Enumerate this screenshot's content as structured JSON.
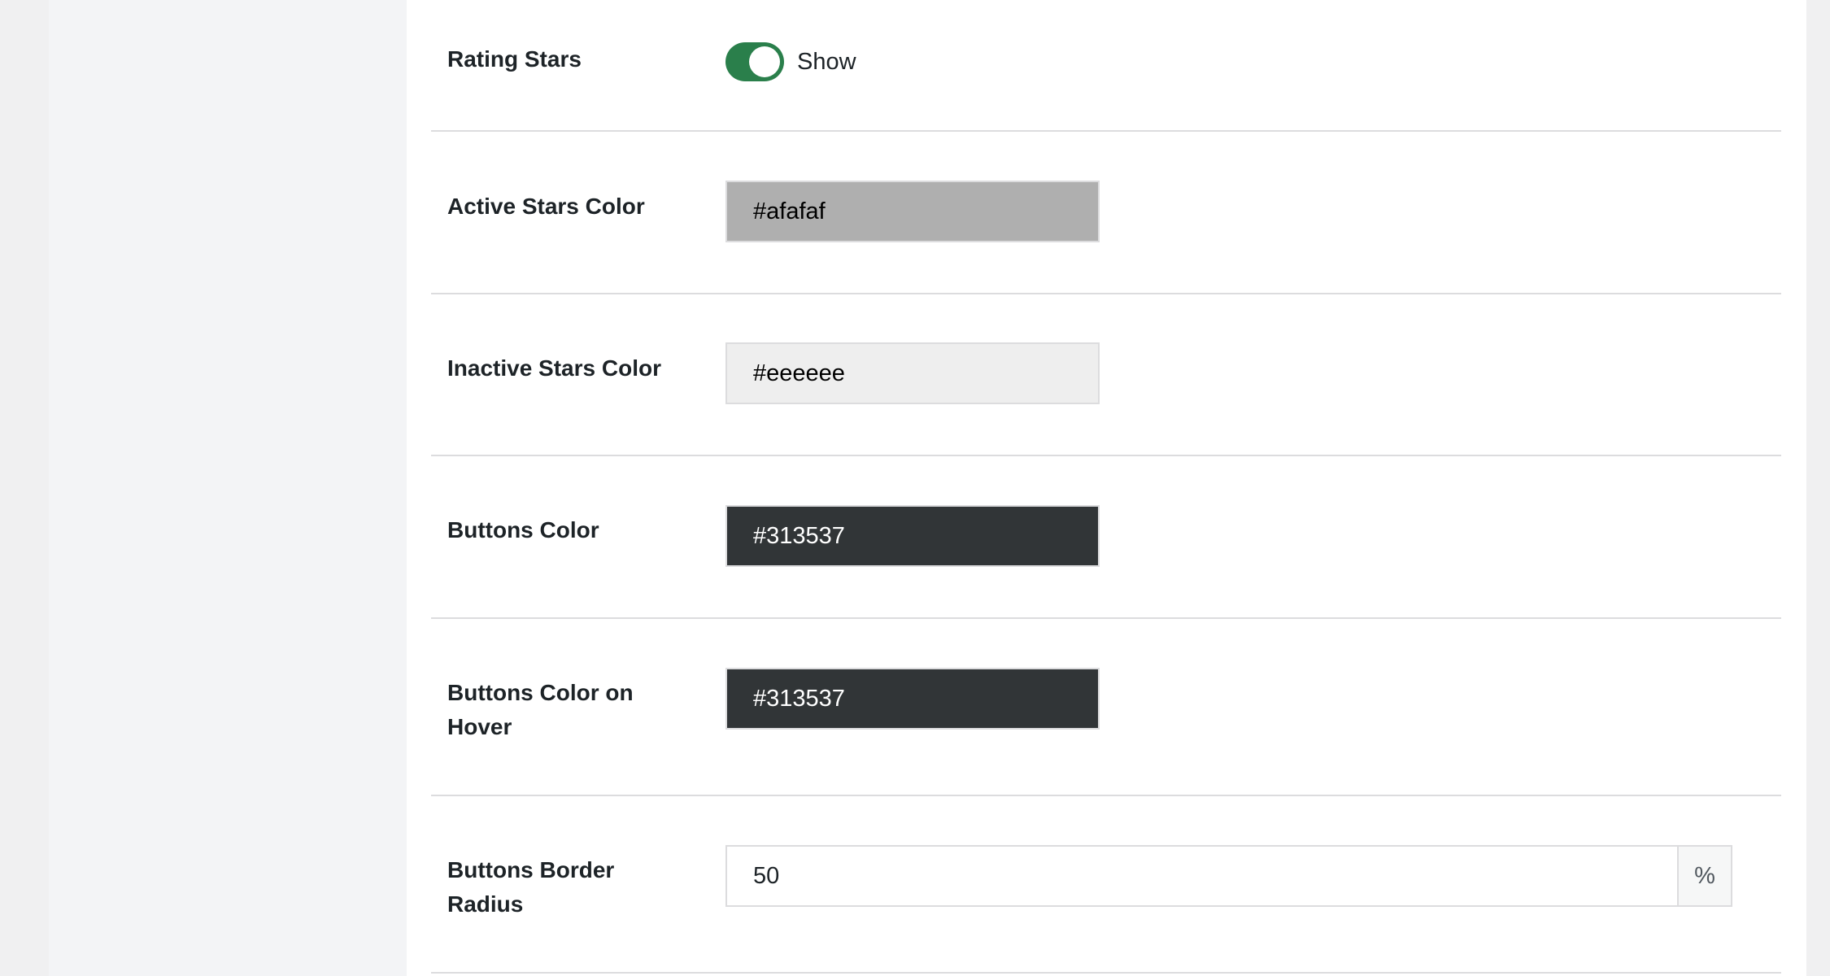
{
  "settings": {
    "rating_stars": {
      "label": "Rating Stars",
      "toggle_text": "Show",
      "enabled": true
    },
    "active_stars_color": {
      "label": "Active Stars Color",
      "value": "#afafaf"
    },
    "inactive_stars_color": {
      "label": "Inactive Stars Color",
      "value": "#eeeeee"
    },
    "buttons_color": {
      "label": "Buttons Color",
      "value": "#313537"
    },
    "buttons_color_hover": {
      "label": "Buttons Color on Hover",
      "value": "#313537"
    },
    "buttons_border_radius": {
      "label": "Buttons Border Radius",
      "value": "50",
      "unit": "%"
    }
  },
  "colors": {
    "toggle_on": "#2a7f4b",
    "active_stars_bg": "#afafaf",
    "inactive_stars_bg": "#eeeeee",
    "buttons_bg": "#313537",
    "buttons_hover_bg": "#313537"
  }
}
